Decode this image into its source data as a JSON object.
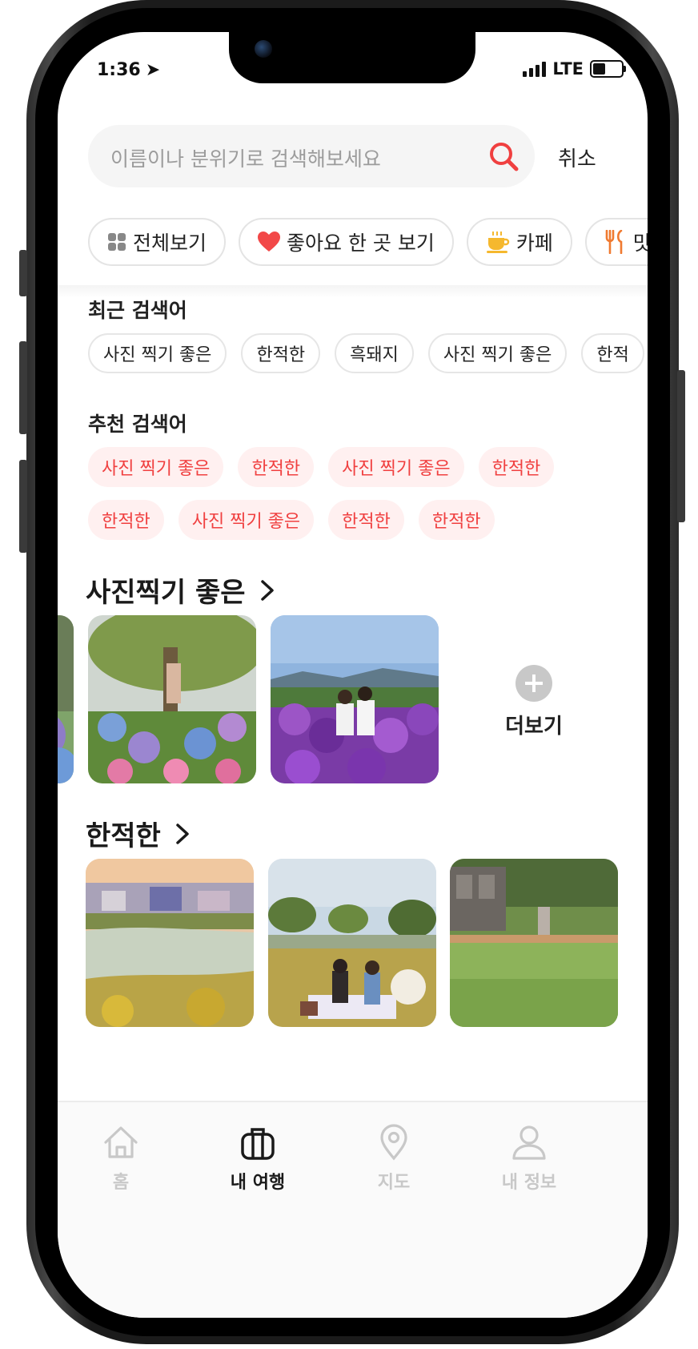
{
  "status_bar": {
    "time": "1:36",
    "network": "LTE"
  },
  "search": {
    "placeholder": "이름이나 분위기로 검색해보세요",
    "cancel_label": "취소"
  },
  "filters": [
    {
      "label": "전체보기",
      "icon": "grid-icon"
    },
    {
      "label": "좋아요 한 곳 보기",
      "icon": "heart-icon"
    },
    {
      "label": "카페",
      "icon": "coffee-icon"
    },
    {
      "label": "맛",
      "icon": "fork-knife-icon"
    }
  ],
  "recent": {
    "title": "최근 검색어",
    "tags": [
      "사진 찍기 좋은",
      "한적한",
      "흑돼지",
      "사진 찍기 좋은",
      "한적"
    ]
  },
  "recommended": {
    "title": "추천 검색어",
    "row1": [
      "사진 찍기 좋은",
      "한적한",
      "사진 찍기 좋은",
      "한적한"
    ],
    "row2": [
      "한적한",
      "사진 찍기 좋은",
      "한적한",
      "한적한"
    ]
  },
  "sections": [
    {
      "title": "사진찍기 좋은",
      "more_label": "더보기"
    },
    {
      "title": "한적한"
    }
  ],
  "tabbar": [
    {
      "label": "홈",
      "icon": "home-icon",
      "active": false
    },
    {
      "label": "내 여행",
      "icon": "bag-icon",
      "active": true
    },
    {
      "label": "지도",
      "icon": "map-pin-icon",
      "active": false
    },
    {
      "label": "내 정보",
      "icon": "person-icon",
      "active": false
    }
  ],
  "colors": {
    "accent": "#f04040",
    "accent_bg": "#fff0f0",
    "heart": "#f24848",
    "coffee": "#f5b82e",
    "food": "#f07a30"
  }
}
